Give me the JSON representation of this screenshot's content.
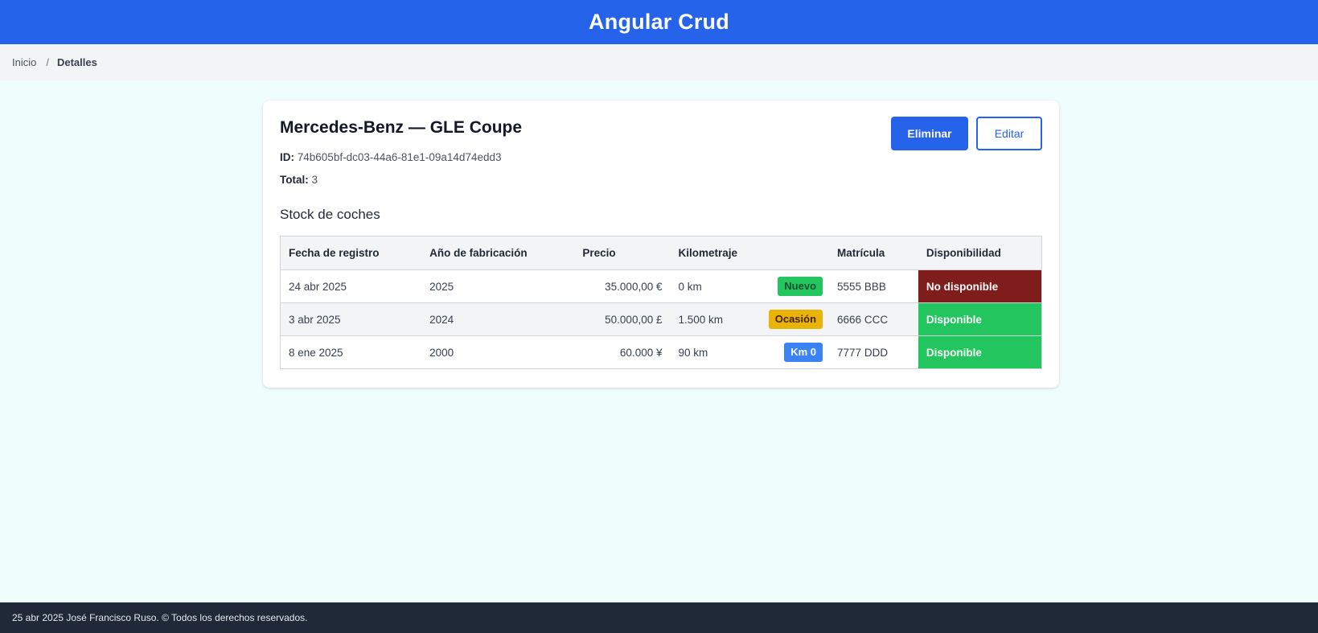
{
  "header": {
    "title": "Angular Crud"
  },
  "breadcrumb": {
    "home": "Inicio",
    "separator": "/",
    "current": "Detalles"
  },
  "detail": {
    "title": "Mercedes-Benz — GLE Coupe",
    "id_label": "ID:",
    "id_value": "74b605bf-dc03-44a6-81e1-09a14d74edd3",
    "total_label": "Total:",
    "total_value": "3",
    "delete_label": "Eliminar",
    "edit_label": "Editar"
  },
  "stock": {
    "title": "Stock de coches",
    "columns": [
      "Fecha de registro",
      "Año de fabricación",
      "Precio",
      "Kilometraje",
      "Matrícula",
      "Disponibilidad"
    ],
    "rows": [
      {
        "date": "24 abr 2025",
        "year": "2025",
        "price": "35.000,00 €",
        "km": "0 km",
        "badge": "Nuevo",
        "plate": "5555 BBB",
        "availability": "No disponible"
      },
      {
        "date": "3 abr 2025",
        "year": "2024",
        "price": "50.000,00 £",
        "km": "1.500 km",
        "badge": "Ocasión",
        "plate": "6666 CCC",
        "availability": "Disponible"
      },
      {
        "date": "8 ene 2025",
        "year": "2000",
        "price": "60.000 ¥",
        "km": "90 km",
        "badge": "Km 0",
        "plate": "7777 DDD",
        "availability": "Disponible"
      }
    ]
  },
  "footer": {
    "text": "25 abr 2025 José Francisco Ruso. © Todos los derechos reservados."
  },
  "colors": {
    "primary": "#2563eb",
    "badge_new": "#22c55e",
    "badge_used": "#eab308",
    "badge_km0": "#3b82f6",
    "unavailable": "#7f1d1d",
    "available": "#22c55e"
  }
}
